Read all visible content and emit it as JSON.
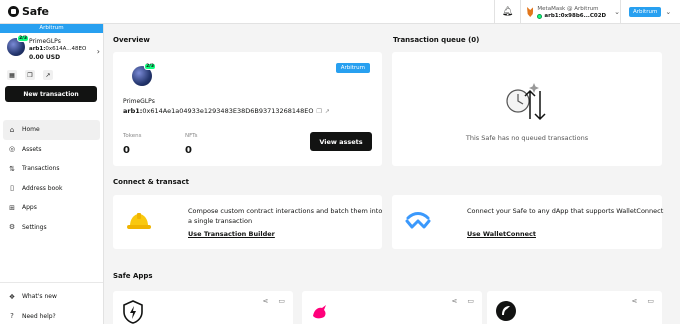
{
  "header": {
    "logo_text": "Safe",
    "wallet_label": "MetaMask @ Arbitrum",
    "wallet_address": "arb1:0x98b6...C02D",
    "network_button": "Arbitrum"
  },
  "sidebar": {
    "chain_label": "Arbitrum",
    "safe_name": "PrimeGLPs",
    "safe_address_prefix": "arb1:",
    "safe_address": "0x614A...48EO",
    "balance": "0.00 USD",
    "threshold": "2/3",
    "new_transaction": "New transaction",
    "nav": [
      {
        "label": "Home",
        "icon": "home-icon"
      },
      {
        "label": "Assets",
        "icon": "assets-icon"
      },
      {
        "label": "Transactions",
        "icon": "transactions-icon"
      },
      {
        "label": "Address book",
        "icon": "address-book-icon"
      },
      {
        "label": "Apps",
        "icon": "apps-icon"
      },
      {
        "label": "Settings",
        "icon": "settings-icon"
      }
    ],
    "bottom": [
      {
        "label": "What's new",
        "icon": "gift-icon"
      },
      {
        "label": "Need help?",
        "icon": "help-icon"
      }
    ]
  },
  "overview": {
    "title": "Overview",
    "chain_badge": "Arbitrum",
    "threshold": "2/3",
    "safe_name": "PrimeGLPs",
    "address_prefix": "arb1:",
    "address": "0x614Ae1a04933e1293483E38D6B93713268148EO",
    "tokens_label": "Tokens",
    "tokens_value": "0",
    "nfts_label": "NFTs",
    "nfts_value": "0",
    "view_assets": "View assets"
  },
  "queue": {
    "title": "Transaction queue (0)",
    "empty_text": "This Safe has no queued transactions"
  },
  "connect": {
    "title": "Connect & transact",
    "builder_text": "Compose custom contract interactions and batch them into a single transaction",
    "builder_link": "Use Transaction Builder",
    "wc_text": "Connect your Safe to any dApp that supports WalletConnect",
    "wc_link": "Use WalletConnect"
  },
  "apps": {
    "title": "Safe Apps"
  },
  "colors": {
    "arbitrum_blue": "#28a0f0",
    "accent_green": "#12ff80",
    "dark": "#121312"
  }
}
